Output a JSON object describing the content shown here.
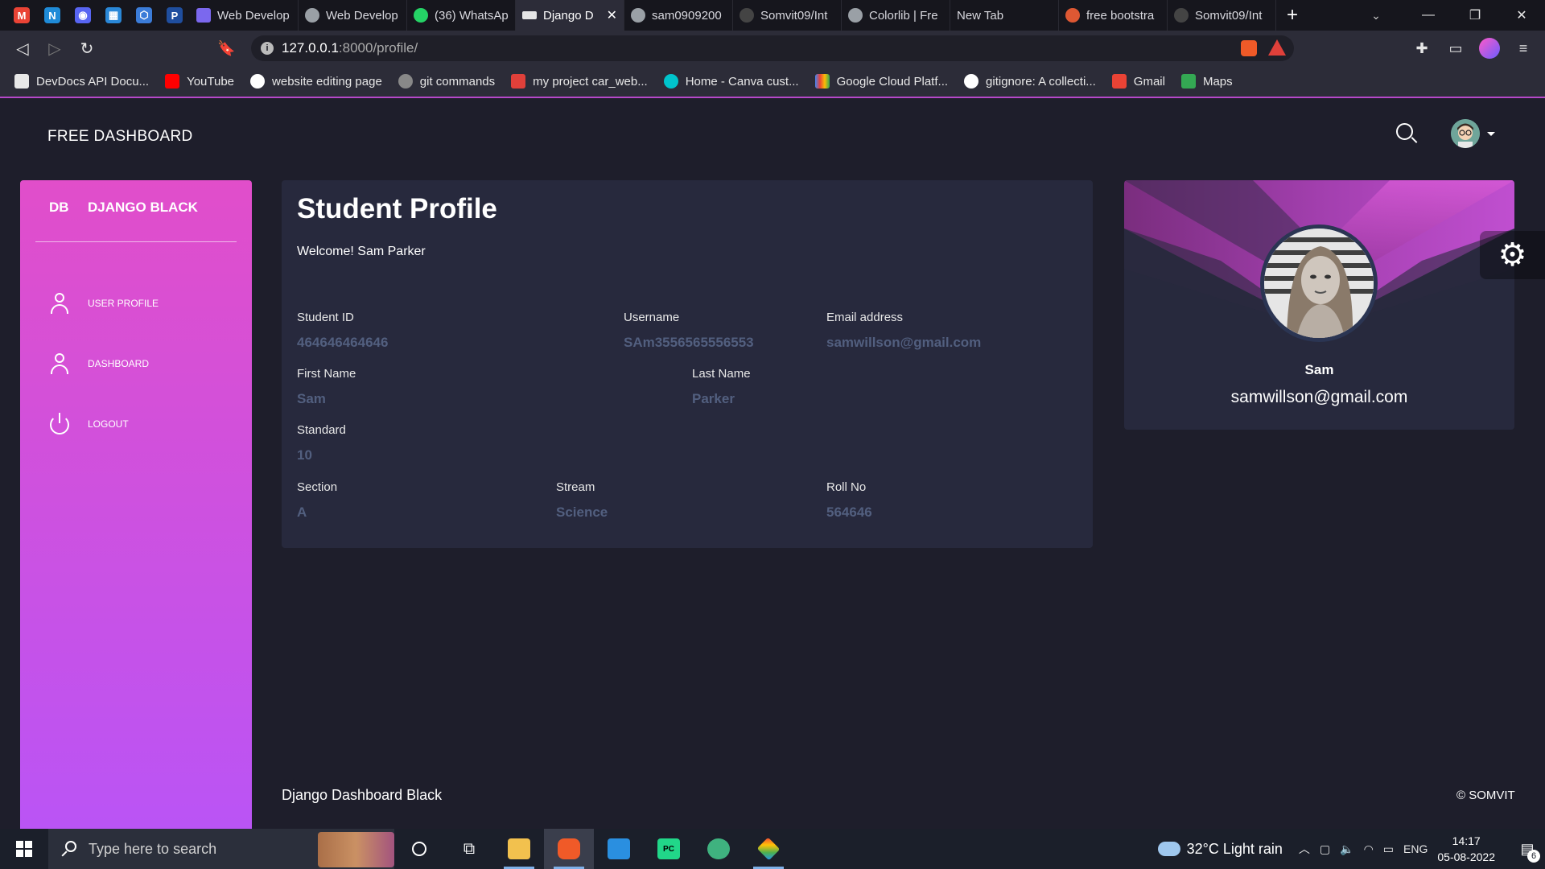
{
  "browser": {
    "tabs": [
      {
        "title": "Web Develop",
        "icon": "page-icon",
        "active": false
      },
      {
        "title": "Web Develop",
        "icon": "globe-icon",
        "active": false
      },
      {
        "title": "(36) WhatsAp",
        "icon": "whatsapp-icon",
        "active": false
      },
      {
        "title": "Django D",
        "icon": "django-icon",
        "active": true
      },
      {
        "title": "sam0909200",
        "icon": "globe-icon",
        "active": false
      },
      {
        "title": "Somvit09/Int",
        "icon": "github-icon",
        "active": false
      },
      {
        "title": "Colorlib | Fre",
        "icon": "globe-icon",
        "active": false
      },
      {
        "title": "New Tab",
        "icon": "",
        "active": false
      },
      {
        "title": "free bootstra",
        "icon": "duckduckgo-icon",
        "active": false
      },
      {
        "title": "Somvit09/Int",
        "icon": "github-icon",
        "active": false
      }
    ],
    "url_host": "127.0.0.1",
    "url_rest": ":8000/profile/",
    "bookmarks": [
      {
        "label": "DevDocs API Docu...",
        "color": "#e8e8e8"
      },
      {
        "label": "YouTube",
        "color": "#ff0000"
      },
      {
        "label": "website editing page",
        "color": "#ffffff"
      },
      {
        "label": "git commands",
        "color": "#888888"
      },
      {
        "label": "my project car_web...",
        "color": "#e0403a"
      },
      {
        "label": "Home - Canva cust...",
        "color": "#00c4cc"
      },
      {
        "label": "Google Cloud Platf...",
        "color": "#4285f4"
      },
      {
        "label": "gitignore: A collecti...",
        "color": "#ffffff"
      },
      {
        "label": "Gmail",
        "color": "#ea4335"
      },
      {
        "label": "Maps",
        "color": "#34a853"
      }
    ]
  },
  "header": {
    "brand": "FREE DASHBOARD"
  },
  "sidebar": {
    "logo": "DB",
    "title": "DJANGO BLACK",
    "items": [
      {
        "label": "USER PROFILE",
        "icon": "user-icon"
      },
      {
        "label": "DASHBOARD",
        "icon": "user-icon"
      },
      {
        "label": "LOGOUT",
        "icon": "power-icon"
      }
    ],
    "gradient_start": "#e14eca",
    "gradient_end": "#ba54f5"
  },
  "profile": {
    "title": "Student Profile",
    "welcome": "Welcome! Sam Parker",
    "fields": {
      "student_id": {
        "label": "Student ID",
        "value": "464646464646"
      },
      "username": {
        "label": "Username",
        "value": "SAm3556565556553"
      },
      "email": {
        "label": "Email address",
        "value": "samwillson@gmail.com"
      },
      "first_name": {
        "label": "First Name",
        "value": "Sam"
      },
      "last_name": {
        "label": "Last Name",
        "value": "Parker"
      },
      "standard": {
        "label": "Standard",
        "value": "10"
      },
      "section": {
        "label": "Section",
        "value": "A"
      },
      "stream": {
        "label": "Stream",
        "value": "Science"
      },
      "roll_no": {
        "label": "Roll No",
        "value": "564646"
      }
    }
  },
  "user_card": {
    "name": "Sam",
    "email": "samwillson@gmail.com"
  },
  "footer": {
    "left": "Django Dashboard Black",
    "right": "© SOMVIT"
  },
  "taskbar": {
    "search_placeholder": "Type here to search",
    "weather": "32°C  Light rain",
    "lang": "ENG",
    "time": "14:17",
    "date": "05-08-2022",
    "notifications": "6"
  }
}
